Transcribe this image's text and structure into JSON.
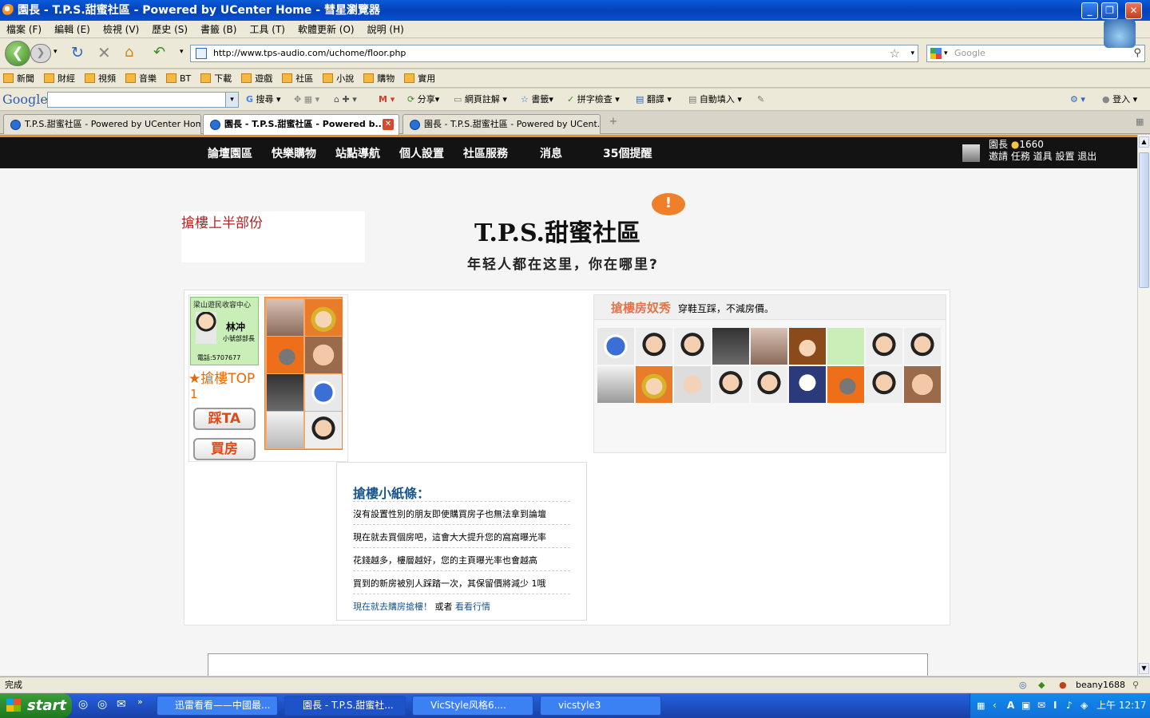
{
  "window": {
    "title": "園長 - T.P.S.甜蜜社區 - Powered by UCenter Home - 彗星瀏覽器"
  },
  "menu": [
    "檔案 (F)",
    "編輯 (E)",
    "檢視 (V)",
    "歷史 (S)",
    "書籤 (B)",
    "工具 (T)",
    "軟體更新 (O)",
    "說明 (H)"
  ],
  "address": {
    "url": "http://www.tps-audio.com/uchome/floor.php",
    "search_placeholder": "Google"
  },
  "bookmarks": [
    "新聞",
    "財經",
    "視頻",
    "音樂",
    "BT",
    "下載",
    "遊戲",
    "社區",
    "小說",
    "購物",
    "實用"
  ],
  "google_toolbar": {
    "logo": "Google",
    "search": "搜尋",
    "share": "分享",
    "annotate": "網頁註解",
    "bookmarks": "書籤",
    "spell": "拼字檢查",
    "translate": "翻譯",
    "autofill": "自動填入",
    "login": "登入"
  },
  "tabs": [
    {
      "label": "T.P.S.甜蜜社區 - Powered by UCenter Home"
    },
    {
      "label": "園長 - T.P.S.甜蜜社區 - Powered b..."
    },
    {
      "label": "園長 - T.P.S.甜蜜社區 - Powered by UCent..."
    }
  ],
  "site_nav": {
    "links": [
      "論壇園區",
      "快樂購物",
      "站點導航",
      "個人設置",
      "社區服務",
      "消息",
      "35個提醒"
    ],
    "user": {
      "name": "園長",
      "coins": "1660",
      "actions": "邀請 任務 道具 設置 退出"
    }
  },
  "banner": {
    "left_label": "搶樓上半部份",
    "logo": "T.P.S.甜蜜社區",
    "slogan": "年轻人都在这里，你在哪里?",
    "badge": "!"
  },
  "floor": {
    "card_title": "梁山遊民收容中心",
    "card_name": "林冲",
    "card_sub": "小號部部長",
    "card_phone": "電話:5707677",
    "top_label": "★搶樓TOP",
    "top_rank": "1",
    "kick_button": "踩TA",
    "buy_button": "買房"
  },
  "slaves": {
    "title": "搶樓房奴秀",
    "subtitle": "穿鞋互踩，不減房價。"
  },
  "tips": {
    "title": "搶樓小紙條：",
    "items": [
      "沒有設置性別的朋友即使購買房子也無法拿到論壇",
      "現在就去買個房吧，這會大大提升您的窩窩曝光率",
      "花錢越多，樓層越好，您的主頁曝光率也會越高",
      "買到的新房被別人踩踏一次，其保留價將減少 1哦"
    ],
    "link_buy": "現在就去購房搶樓！",
    "or": "或者",
    "link_market": "看看行情"
  },
  "status": {
    "text": "完成",
    "user": "beany1688"
  },
  "taskbar": {
    "start": "start",
    "tasks": [
      "迅雷看看——中國最...",
      "園長 - T.P.S.甜蜜社...",
      "VicStyle风格6....",
      "vicstyle3"
    ],
    "clock": "上午 12:17"
  },
  "colors": {
    "accent": "#f18c1e",
    "nav_bg": "#131313",
    "tip_title": "#17558d",
    "slave_title": "#e8734a"
  }
}
